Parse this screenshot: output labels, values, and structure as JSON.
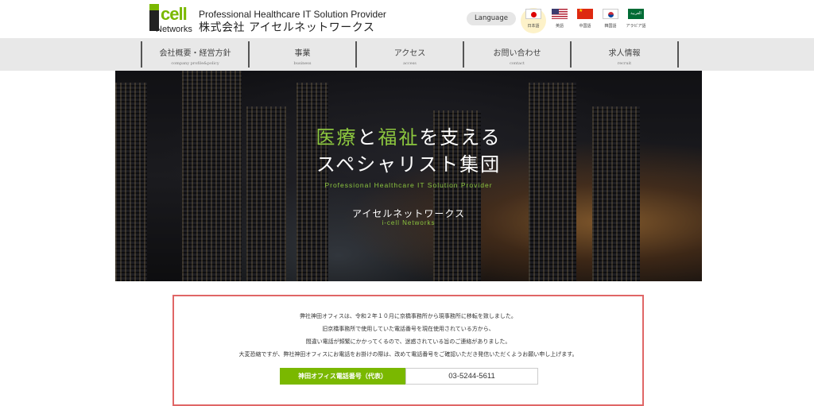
{
  "header": {
    "logo": {
      "mark": "i-",
      "cell": "cell",
      "networks": "Networks"
    },
    "tagline": "Professional Healthcare IT Solution Provider",
    "company_name": "株式会社 アイセルネットワークス"
  },
  "language": {
    "button_label": "Language",
    "flags": [
      {
        "label": "日本語",
        "icon": "japan-flag-icon",
        "active": true
      },
      {
        "label": "英語",
        "icon": "us-flag-icon"
      },
      {
        "label": "中国語",
        "icon": "china-flag-icon"
      },
      {
        "label": "韓国語",
        "icon": "korea-flag-icon"
      },
      {
        "label": "アラビア語",
        "icon": "saudi-flag-icon",
        "glyph": "العربية"
      }
    ]
  },
  "nav": {
    "items": [
      {
        "label": "会社概要・経営方針",
        "sub": "company profile&policy"
      },
      {
        "label": "事業",
        "sub": "business"
      },
      {
        "label": "アクセス",
        "sub": "access"
      },
      {
        "label": "お問い合わせ",
        "sub": "contact"
      },
      {
        "label": "求人情報",
        "sub": "recruit"
      }
    ]
  },
  "hero": {
    "catch_hl1": "医療",
    "catch_mid": "と",
    "catch_hl2": "福祉",
    "catch_end": "を支える",
    "catch_line2": "スペシャリスト集団",
    "catch_en": "Professional Healthcare IT Solution Provider",
    "company": "アイセルネットワークス",
    "company_en": "i-cell Networks",
    "colors": {
      "highlight": "#8cc63f"
    }
  },
  "notice": {
    "lines": [
      "弊社神田オフィスは、令和２年１０月に京橋事務所から現事務所に移転を致しました。",
      "旧京橋事務所で使用していた電話番号を現在使用されている方から、",
      "間違い電話が頻繁にかかってくるので、迷惑されている旨のご連絡がありました。",
      "大変恐縮ですが、弊社神田オフィスにお電話をお掛けの際は、改めて電話番号をご確認いただき発信いただくようお願い申し上げます。"
    ],
    "phone_label": "神田オフィス電話番号（代表）",
    "phone_value": "03-5244-5611",
    "colors": {
      "border": "#e06666",
      "label_bg": "#7ab800"
    }
  }
}
